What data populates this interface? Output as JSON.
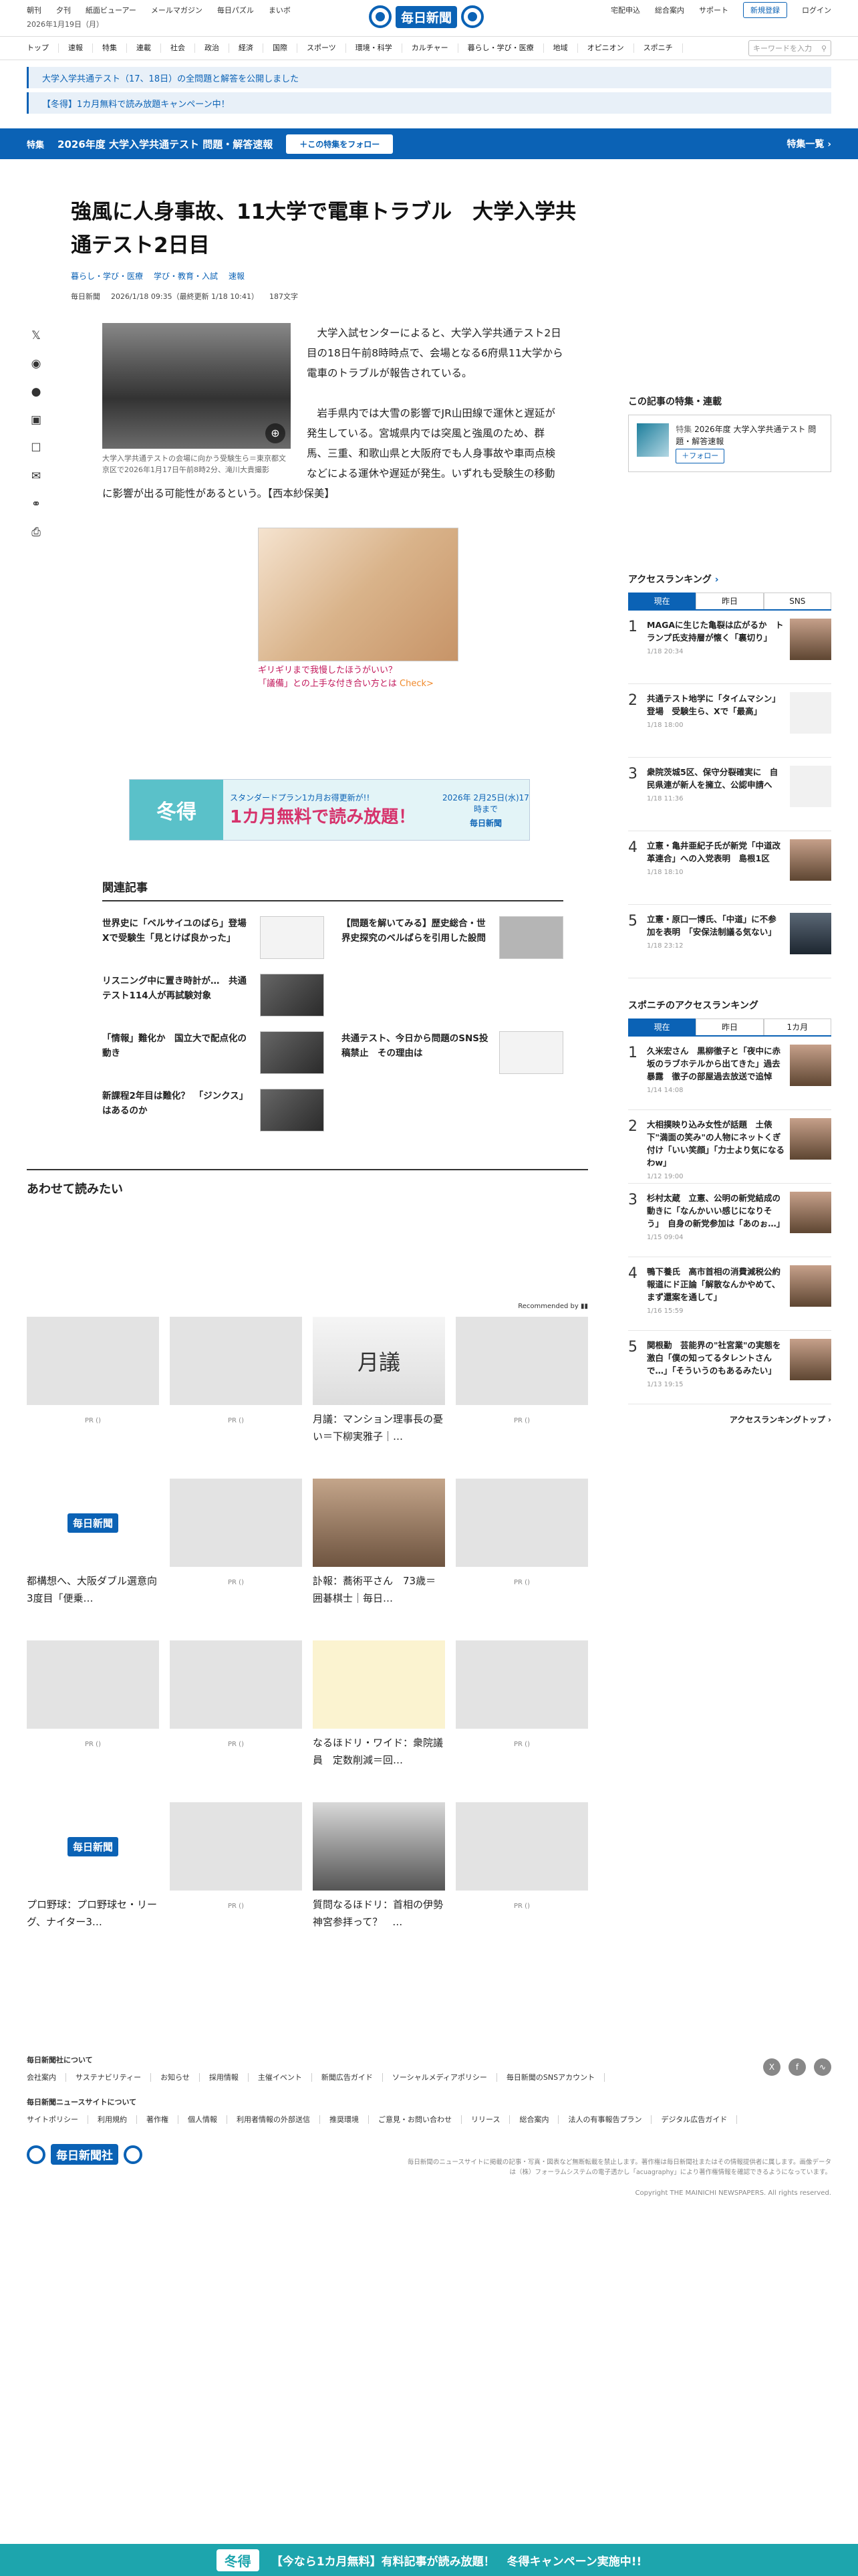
{
  "header": {
    "left_links": [
      "朝刊",
      "夕刊",
      "紙面ビューアー",
      "メールマガジン",
      "毎日パズル",
      "まいボ"
    ],
    "logo": "毎日新聞",
    "right_links": [
      "宅配申込",
      "総合案内",
      "サポート"
    ],
    "register": "新規登録",
    "login": "ログイン",
    "date": "2026年1月19日（月）"
  },
  "gnav": {
    "items": [
      "トップ",
      "速報",
      "特集",
      "連載",
      "社会",
      "政治",
      "経済",
      "国際",
      "スポーツ",
      "環境・科学",
      "カルチャー",
      "暮らし・学び・医療",
      "地域",
      "オピニオン",
      "スポニチ"
    ],
    "search_placeholder": "キーワードを入力"
  },
  "notices": [
    "大学入学共通テスト（17、18日）の全問題と解答を公開しました",
    "【冬得】1カ月無料で読み放題キャンペーン中！"
  ],
  "feature": {
    "tag": "特集",
    "title": "2026年度 大学入学共通テスト 問題・解答速報",
    "follow": "＋この特集をフォロー",
    "more": "特集一覧"
  },
  "article": {
    "title": "強風に人身事故、11大学で電車トラブル　大学入学共通テスト2日目",
    "categories": [
      "暮らし・学び・医療",
      "学び・教育・入試",
      "速報"
    ],
    "source": "毎日新聞",
    "datetime": "2026/1/18 09:35（最終更新 1/18 10:41）",
    "length": "187文字",
    "caption": "大学入学共通テストの会場に向かう受験生ら＝東京都文京区で2026年1月17日午前8時2分、滝川大貴撮影",
    "p1": "大学入試センターによると、大学入学共通テスト2日目の18日午前8時時点で、会場となる6府県11大学から電車のトラブルが報告されている。",
    "p2": "岩手県内では大雪の影響でJR山田線で運休と遅延が発生している。宮城県内では突風と強風のため、群馬、三重、和歌山県と大阪府でも人身事故や車両点検などによる運休や遅延が発生。いずれも受験生の移動に影響が出る可能性があるという。【西本紗保美】"
  },
  "share_icons": [
    "x-icon",
    "hatena-icon",
    "facebook-icon",
    "note-icon",
    "bookmark-icon",
    "mail-icon",
    "link-icon",
    "print-icon"
  ],
  "ad1": {
    "line1": "ギリギリまで我慢したほうがいい？",
    "line2": "「議備」との上手な付き合い方とは",
    "cta": "Check>"
  },
  "ad2": {
    "left": "冬得",
    "small": "スタンダードプラン1カ月お得更新が!!",
    "big": "1カ月無料で読み放題！",
    "right": "2026年 2月25日(水)17時まで",
    "brand": "毎日新聞"
  },
  "related": {
    "heading": "関連記事",
    "items": [
      "世界史に「ベルサイユのばら」登場　Xで受験生「見とけば良かった」",
      "【問題を解いてみる】歴史総合・世界史探究のベルばらを引用した設問",
      "リスニング中に置き時計が…　共通テスト114人が再試験対象",
      "「情報」難化か　国立大で配点化の動き",
      "共通テスト、今日から問題のSNS投稿禁止　その理由は",
      "新課程2年目は難化？　「ジンクス」はあるのか"
    ]
  },
  "together": {
    "heading": "あわせて読みたい",
    "recommended": "Recommended by",
    "cards": [
      {
        "title": "",
        "pr": "PR ()"
      },
      {
        "title": "",
        "pr": "PR ()"
      },
      {
        "title": "月議：マンション理事長の憂い＝下柳実雅子｜…",
        "pr": ""
      },
      {
        "title": "",
        "pr": "PR ()"
      },
      {
        "title": "都構想へ、大阪ダブル選意向　3度目「便乗…",
        "pr": ""
      },
      {
        "title": "",
        "pr": "PR ()"
      },
      {
        "title": "訃報：蕎術平さん　73歳＝囲碁棋士｜毎日…",
        "pr": ""
      },
      {
        "title": "",
        "pr": "PR ()"
      },
      {
        "title": "",
        "pr": "PR ()"
      },
      {
        "title": "",
        "pr": "PR ()"
      },
      {
        "title": "なるほドリ・ワイド：衆院議員　定数削減＝回…",
        "pr": ""
      },
      {
        "title": "",
        "pr": "PR ()"
      },
      {
        "title": "プロ野球：プロ野球セ・リーグ、ナイター3…",
        "pr": ""
      },
      {
        "title": "",
        "pr": "PR ()"
      },
      {
        "title": "質問なるほドリ：首相の伊勢神宮参拝って？　…",
        "pr": ""
      },
      {
        "title": "",
        "pr": "PR ()"
      }
    ]
  },
  "sidebar": {
    "feature_heading": "この記事の特集・連載",
    "feature_tag": "特集",
    "feature_title": "2026年度 大学入学共通テスト 問題・解答速報",
    "feature_follow": "＋フォロー",
    "rank_heading": "アクセスランキング",
    "rank_tabs": [
      "現在",
      "昨日",
      "SNS"
    ],
    "rank_items": [
      {
        "n": "1",
        "t": "MAGAに生じた亀裂は広がるか　トランプ氏支持層が懐く「裏切り」",
        "d": "1/18 20:34"
      },
      {
        "n": "2",
        "t": "共通テスト地学に「タイムマシン」登場　受験生ら、Xで「最高」",
        "d": "1/18 18:00"
      },
      {
        "n": "3",
        "t": "衆院茨城5区、保守分裂確実に　自民県連が新人を擁立、公認申請へ",
        "d": "1/18 11:36"
      },
      {
        "n": "4",
        "t": "立憲・亀井亜紀子氏が新党「中道改革連合」への入党表明　島根1区",
        "d": "1/18 18:10"
      },
      {
        "n": "5",
        "t": "立憲・原口一博氏、「中道」に不参加を表明　「安保法制議る気ない」",
        "d": "1/18 23:12"
      }
    ],
    "sp_heading": "スポニチのアクセスランキング",
    "sp_tabs": [
      "現在",
      "昨日",
      "1カ月"
    ],
    "sp_items": [
      {
        "n": "1",
        "t": "久米宏さん　黒柳徹子と「夜中に赤坂のラブホテルから出てきた」過去暴露　徹子の部屋過去放送で追悼",
        "d": "1/14 14:08"
      },
      {
        "n": "2",
        "t": "大相撲映り込み女性が話題　土俵下\"満面の笑み\"の人物にネットくぎ付け「いい笑顔」「力士より気になるわw」",
        "d": "1/12 19:00"
      },
      {
        "n": "3",
        "t": "杉村太蔵　立憲、公明の新党結成の動きに「なんかいい感じになりそう」　自身の新党参加は「あのぉ…」",
        "d": "1/15 09:04"
      },
      {
        "n": "4",
        "t": "鴨下養氏　高市首相の消費減税公約報道にド正論「解散なんかやめて、まず還案を通して」",
        "d": "1/16 15:59"
      },
      {
        "n": "5",
        "t": "関根勤　芸能界の\"社宮業\"の実態を激白「僕の知ってるタレントさんで…」「そういうのもあるみたい」",
        "d": "1/13 19:15"
      }
    ],
    "rank_more": "アクセスランキングトップ"
  },
  "footer": {
    "h1": "毎日新聞社について",
    "links1": [
      "会社案内",
      "サステナビリティー",
      "お知らせ",
      "採用情報",
      "主催イベント",
      "新聞広告ガイド",
      "ソーシャルメディアポリシー",
      "毎日新聞のSNSアカウント"
    ],
    "h2": "毎日新聞ニュースサイトについて",
    "links2": [
      "サイトポリシー",
      "利用規約",
      "著作権",
      "個人情報",
      "利用者情報の外部送信",
      "推奨環境",
      "ご意見・お問い合わせ",
      "リリース",
      "総合案内",
      "法人の有事報告プラン",
      "デジタル広告ガイド"
    ],
    "logo": "毎日新聞社",
    "legal": "毎日新聞のニュースサイトに掲載の記事・写真・図表など無断転載を禁止します。著作権は毎日新聞社またはその情報提供者に属します。画像データは（株）フォーラムシステムの電子透かし「acuagraphy」により著作権情報を確認できるようになっています。",
    "copyright": "Copyright THE MAINICHI NEWSPAPERS. All rights reserved."
  },
  "banner": {
    "badge": "冬得",
    "text": "【今なら1カ月無料】有料記事が読み放題！",
    "right": "冬得キャンペーン実施中!!"
  }
}
